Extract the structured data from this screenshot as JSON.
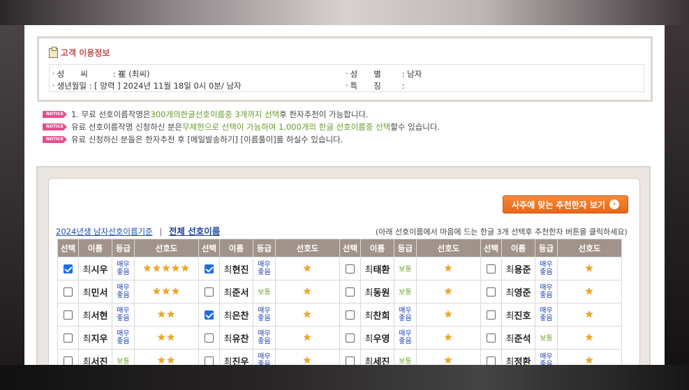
{
  "customer": {
    "section_title": "고객 이용정보",
    "surname_label": "성　　씨",
    "surname_value": "崔 (최씨)",
    "gender_label": "성　　별",
    "gender_value": "남자",
    "birth_label": "생년월일",
    "birth_value": "[ 양력 ] 2024년 11월 18일 0시 0분/ 남자",
    "feature_label": "특　　징",
    "feature_value": ""
  },
  "notices": {
    "badge": "NOTICE",
    "line1_a": "1. 무료 선호이름작명은 ",
    "line1_hl1": "300개의",
    "line1_b": " ",
    "line1_hl2": "한글선호이름중 3개까지 선택",
    "line1_c": "후 한자추천이 가능합니다.",
    "line2_a": "유료 선호이름작명 신청하신 분은",
    "line2_hl1": "무제한으로 선택이 가능하며 1,000개의 한글 선호이름중 선택",
    "line2_b": "할수 있습니다.",
    "line3": "유료 신청하신 분들은 한자추천 후 [메일발송하기] [이름풀이]를 하실수 있습니다."
  },
  "list": {
    "recommend_button": "사주에 맞는 추천한자 보기",
    "recommend_arrow": "›",
    "link_year": "2024년생 남자선호이름기준",
    "link_sep": "|",
    "link_all": "전체 선호이름",
    "hint": "(아래 선호이름에서 마음에 드는 한글 3개 선택후 추천한자 버튼을 클릭하세요)",
    "headers": [
      "선택",
      "이름",
      "등급",
      "선호도"
    ],
    "rows": [
      [
        {
          "checked": true,
          "sur": "최",
          "given": "시우",
          "grade": "매우좋음",
          "stars": "★★★★★"
        },
        {
          "checked": true,
          "sur": "최",
          "given": "현진",
          "grade": "매우좋음",
          "stars": "★"
        },
        {
          "checked": false,
          "sur": "최",
          "given": "태환",
          "grade": "보통",
          "stars": "★"
        },
        {
          "checked": false,
          "sur": "최",
          "given": "용준",
          "grade": "매우좋음",
          "stars": "★"
        }
      ],
      [
        {
          "checked": false,
          "sur": "최",
          "given": "민서",
          "grade": "매우좋음",
          "stars": "★★★"
        },
        {
          "checked": false,
          "sur": "최",
          "given": "준서",
          "grade": "보통",
          "stars": "★"
        },
        {
          "checked": false,
          "sur": "최",
          "given": "동원",
          "grade": "보통",
          "stars": "★"
        },
        {
          "checked": false,
          "sur": "최",
          "given": "영준",
          "grade": "매우좋음",
          "stars": "★"
        }
      ],
      [
        {
          "checked": false,
          "sur": "최",
          "given": "서현",
          "grade": "매우좋음",
          "stars": "★★"
        },
        {
          "checked": true,
          "sur": "최",
          "given": "은찬",
          "grade": "매우좋음",
          "stars": "★"
        },
        {
          "checked": false,
          "sur": "최",
          "given": "찬희",
          "grade": "매우좋음",
          "stars": "★"
        },
        {
          "checked": false,
          "sur": "최",
          "given": "진호",
          "grade": "매우좋음",
          "stars": "★"
        }
      ],
      [
        {
          "checked": false,
          "sur": "최",
          "given": "지우",
          "grade": "매우좋음",
          "stars": "★★"
        },
        {
          "checked": false,
          "sur": "최",
          "given": "유찬",
          "grade": "매우좋음",
          "stars": "★"
        },
        {
          "checked": false,
          "sur": "최",
          "given": "우영",
          "grade": "매우좋음",
          "stars": "★"
        },
        {
          "checked": false,
          "sur": "최",
          "given": "준석",
          "grade": "보통",
          "stars": "★"
        }
      ],
      [
        {
          "checked": false,
          "sur": "최",
          "given": "서진",
          "grade": "보통",
          "stars": "★★"
        },
        {
          "checked": false,
          "sur": "최",
          "given": "진우",
          "grade": "매우좋음",
          "stars": "★"
        },
        {
          "checked": false,
          "sur": "최",
          "given": "세진",
          "grade": "보통",
          "stars": "★"
        },
        {
          "checked": false,
          "sur": "최",
          "given": "정환",
          "grade": "매우좋음",
          "stars": "★"
        }
      ]
    ]
  }
}
